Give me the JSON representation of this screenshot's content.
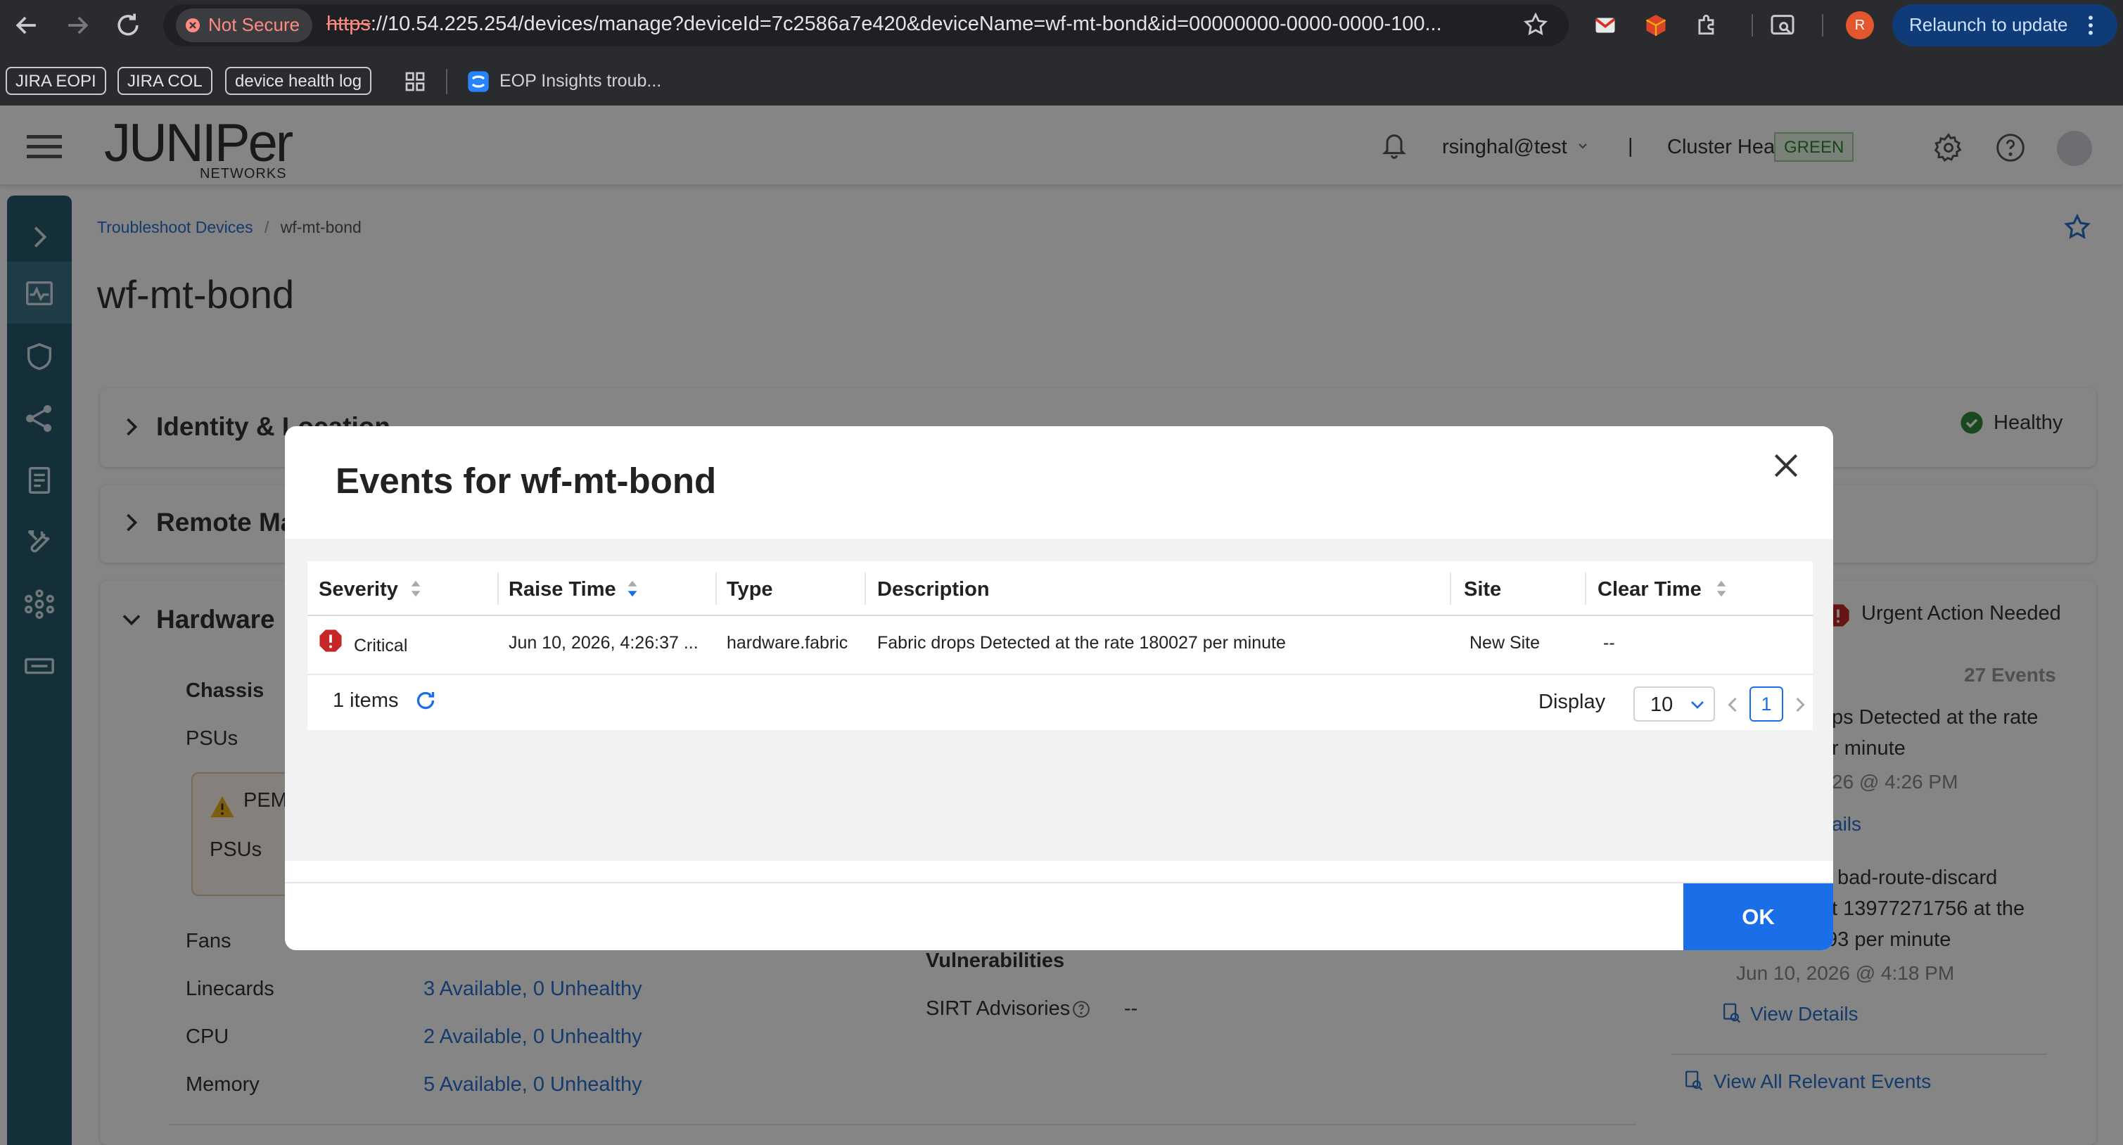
{
  "browser": {
    "not_secure_label": "Not Secure",
    "url_scheme": "https",
    "url_rest": "://10.54.225.254/devices/manage?deviceId=7c2586a7e420&deviceName=wf-mt-bond&id=00000000-0000-0000-100...",
    "relaunch_label": "Relaunch to update",
    "profile_initial": "R",
    "bookmarks": [
      "JIRA EOPI",
      "JIRA COL",
      "device health log"
    ],
    "bookmark_link": "EOP Insights troub..."
  },
  "header": {
    "logo_main": "JUNIPer",
    "logo_sub": "NETWORKS",
    "user": "rsinghal@test",
    "cluster_label": "Cluster Health:",
    "cluster_status": "GREEN",
    "separator": "|"
  },
  "breadcrumb": {
    "parent": "Troubleshoot Devices",
    "separator": "/",
    "current": "wf-mt-bond"
  },
  "page_title": "wf-mt-bond",
  "sections": {
    "identity": "Identity & Location",
    "identity_status": "Healthy",
    "remote": "Remote Ma",
    "hardware": "Hardware"
  },
  "hardware": {
    "chassis": "Chassis",
    "psus": "PSUs",
    "pem_label": "PEM",
    "pem_sub": "PSUs",
    "fans": "Fans",
    "linecards": "Linecards",
    "linecards_value": "3 Available, 0 Unhealthy",
    "cpu": "CPU",
    "cpu_value": "2 Available, 0 Unhealthy",
    "memory": "Memory",
    "memory_value": "5 Available, 0 Unhealthy",
    "vulnerabilities": "Vulnerabilities",
    "sirt_label": "SIRT Advisories",
    "sirt_value": "--"
  },
  "events_panel": {
    "status": "Urgent Action Needed",
    "count": "27 Events",
    "event1_line1": "ps Detected at the rate",
    "event1_line2": "r minute",
    "event1_time": "26 @ 4:26 PM",
    "event1_details": "ails",
    "event2_line1": "bad-route-discard",
    "event2_line2": "t 13977271756 at the",
    "event2_line3": "93 per minute",
    "event2_time": "Jun 10, 2026 @ 4:18 PM",
    "view_details": "View Details",
    "view_all": "View All Relevant Events"
  },
  "modal": {
    "title": "Events for wf-mt-bond",
    "columns": [
      "Severity",
      "Raise Time",
      "Type",
      "Description",
      "Site",
      "Clear Time"
    ],
    "rows": [
      {
        "severity": "Critical",
        "raise_time": "Jun 10, 2026, 4:26:37 ...",
        "type": "hardware.fabric",
        "description": "Fabric drops Detected at the rate 180027 per minute",
        "site": "New Site",
        "clear_time": "--"
      }
    ],
    "items_count": "1 items",
    "display_label": "Display",
    "page_size": "10",
    "current_page": "1",
    "ok_label": "OK"
  },
  "colors": {
    "accent": "#1a6fe8",
    "sidebar": "#2a5a6b",
    "critical": "#c62828",
    "healthy": "#2e8b3a"
  }
}
